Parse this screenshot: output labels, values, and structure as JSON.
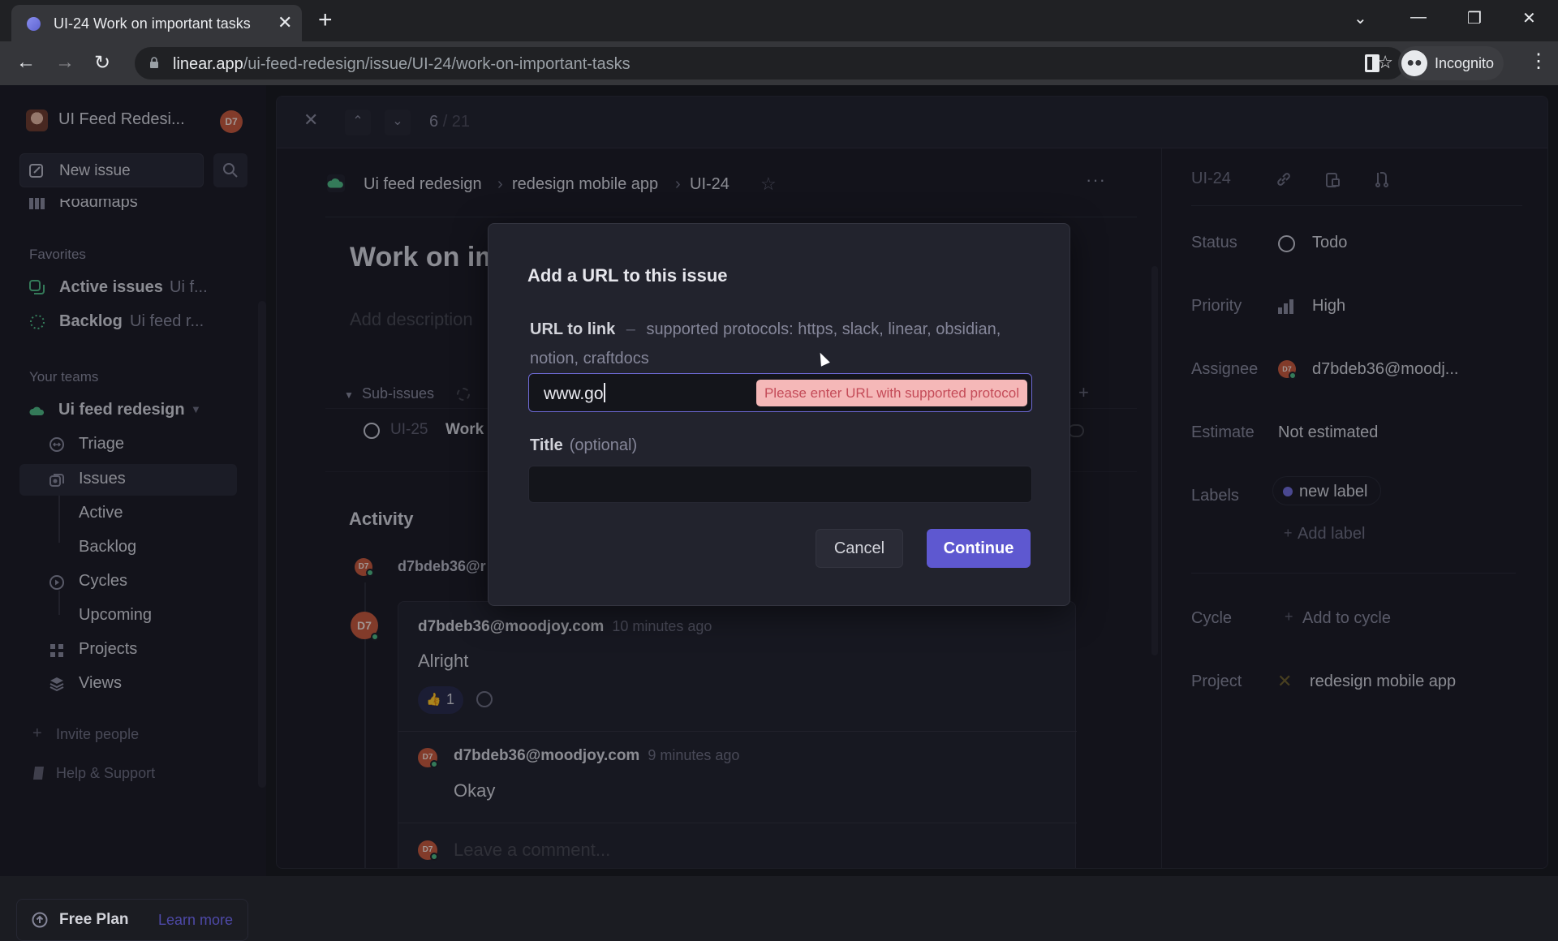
{
  "browser": {
    "tab_title": "UI-24 Work on important tasks",
    "url_host": "linear.app",
    "url_path": "/ui-feed-redesign/issue/UI-24/work-on-important-tasks",
    "profile_label": "Incognito"
  },
  "sidebar": {
    "workspace_name": "UI Feed Redesi...",
    "user_initials": "D7",
    "new_issue_label": "New issue",
    "partial_item": "Roadmaps",
    "favorites_heading": "Favorites",
    "favorites": [
      {
        "label": "Active issues",
        "sub": "Ui f..."
      },
      {
        "label": "Backlog",
        "sub": "Ui feed r..."
      }
    ],
    "teams_heading": "Your teams",
    "team_name": "Ui feed redesign",
    "team_items": [
      {
        "label": "Triage"
      },
      {
        "label": "Issues"
      },
      {
        "label": "Active"
      },
      {
        "label": "Backlog"
      },
      {
        "label": "Cycles"
      },
      {
        "label": "Upcoming"
      },
      {
        "label": "Projects"
      },
      {
        "label": "Views"
      }
    ],
    "invite_label": "Invite people",
    "help_label": "Help & Support",
    "plan_label": "Free Plan",
    "learn_more_label": "Learn more",
    "accent_color": "#5e58d0"
  },
  "issue_header": {
    "position": "6",
    "total": "/ 21"
  },
  "breadcrumb": {
    "team": "Ui feed redesign",
    "project": "redesign mobile app",
    "issue_id": "UI-24"
  },
  "issue": {
    "title_visible": "Work on im",
    "description_placeholder": "Add description",
    "subissues_label": "Sub-issues",
    "subissue": {
      "id": "UI-25",
      "title_visible": "Work"
    },
    "activity_heading": "Activity",
    "activity_author_visible": "d7bdeb36@r"
  },
  "comments": [
    {
      "author": "d7bdeb36@moodjoy.com",
      "time": "10 minutes ago",
      "body": "Alright",
      "reaction_count": "1"
    },
    {
      "author": "d7bdeb36@moodjoy.com",
      "time": "9 minutes ago",
      "body": "Okay"
    }
  ],
  "comment_input": {
    "placeholder": "Leave a comment..."
  },
  "right_panel": {
    "issue_id": "UI-24",
    "status_label": "Status",
    "status_value": "Todo",
    "priority_label": "Priority",
    "priority_value": "High",
    "assignee_label": "Assignee",
    "assignee_value": "d7bdeb36@moodj...",
    "estimate_label": "Estimate",
    "estimate_value": "Not estimated",
    "labels_label": "Labels",
    "label_chip": "new label",
    "label_color": "#6e6ad6",
    "add_label": "Add label",
    "cycle_label": "Cycle",
    "cycle_value": "Add to cycle",
    "project_label": "Project",
    "project_value": "redesign mobile app"
  },
  "modal": {
    "title": "Add a URL to this issue",
    "url_label": "URL to link",
    "url_hint": "supported protocols: https, slack, linear, obsidian, notion, craftdocs",
    "url_value": "www.go",
    "error": "Please enter URL with supported protocol",
    "title_label": "Title",
    "title_optional": "(optional)",
    "title_value": "",
    "cancel": "Cancel",
    "continue": "Continue",
    "error_color": "#c44b58"
  }
}
